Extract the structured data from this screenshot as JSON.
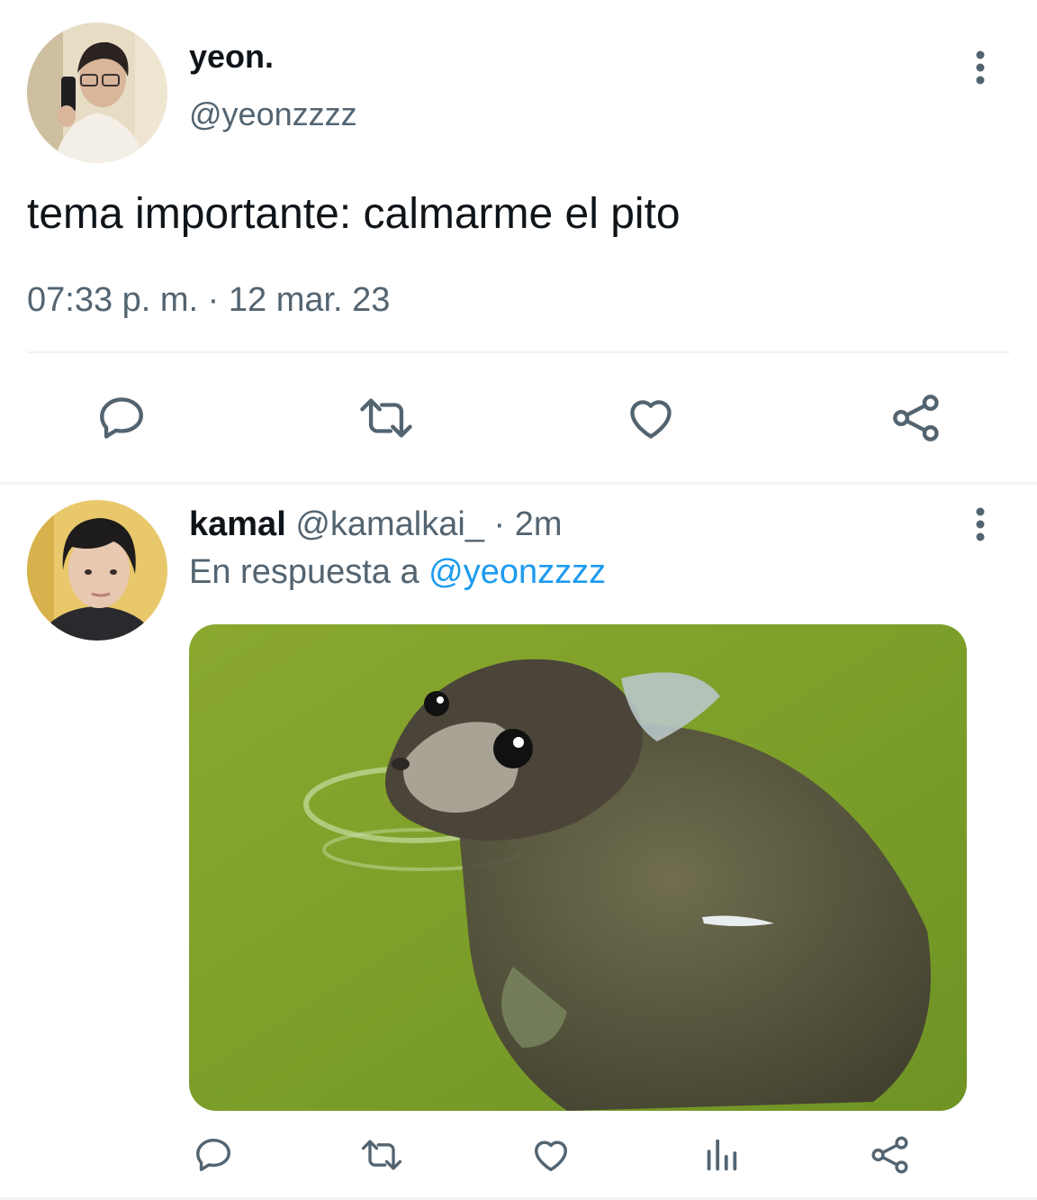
{
  "colors": {
    "icon": "#536471",
    "text": "#0f1419",
    "muted": "#536471",
    "link": "#1d9bf0",
    "divider": "#eff3f4",
    "water": "#7ea02c"
  },
  "main_tweet": {
    "display_name": "yeon.",
    "handle": "@yeonzzzz",
    "text": "tema importante: calmarme el pito",
    "timestamp": "07:33 p. m. · 12 mar. 23",
    "actions": [
      "reply-icon",
      "retweet-icon",
      "like-icon",
      "share-icon"
    ]
  },
  "reply_tweet": {
    "display_name": "kamal",
    "handle": "@kamalkai_",
    "time": "· 2m",
    "reply_prefix": "En respuesta a",
    "reply_to": "@yeonzzzz",
    "media": "photo of a seal in green water",
    "actions": [
      "reply-icon",
      "retweet-icon",
      "like-icon",
      "views-icon",
      "share-icon"
    ]
  }
}
